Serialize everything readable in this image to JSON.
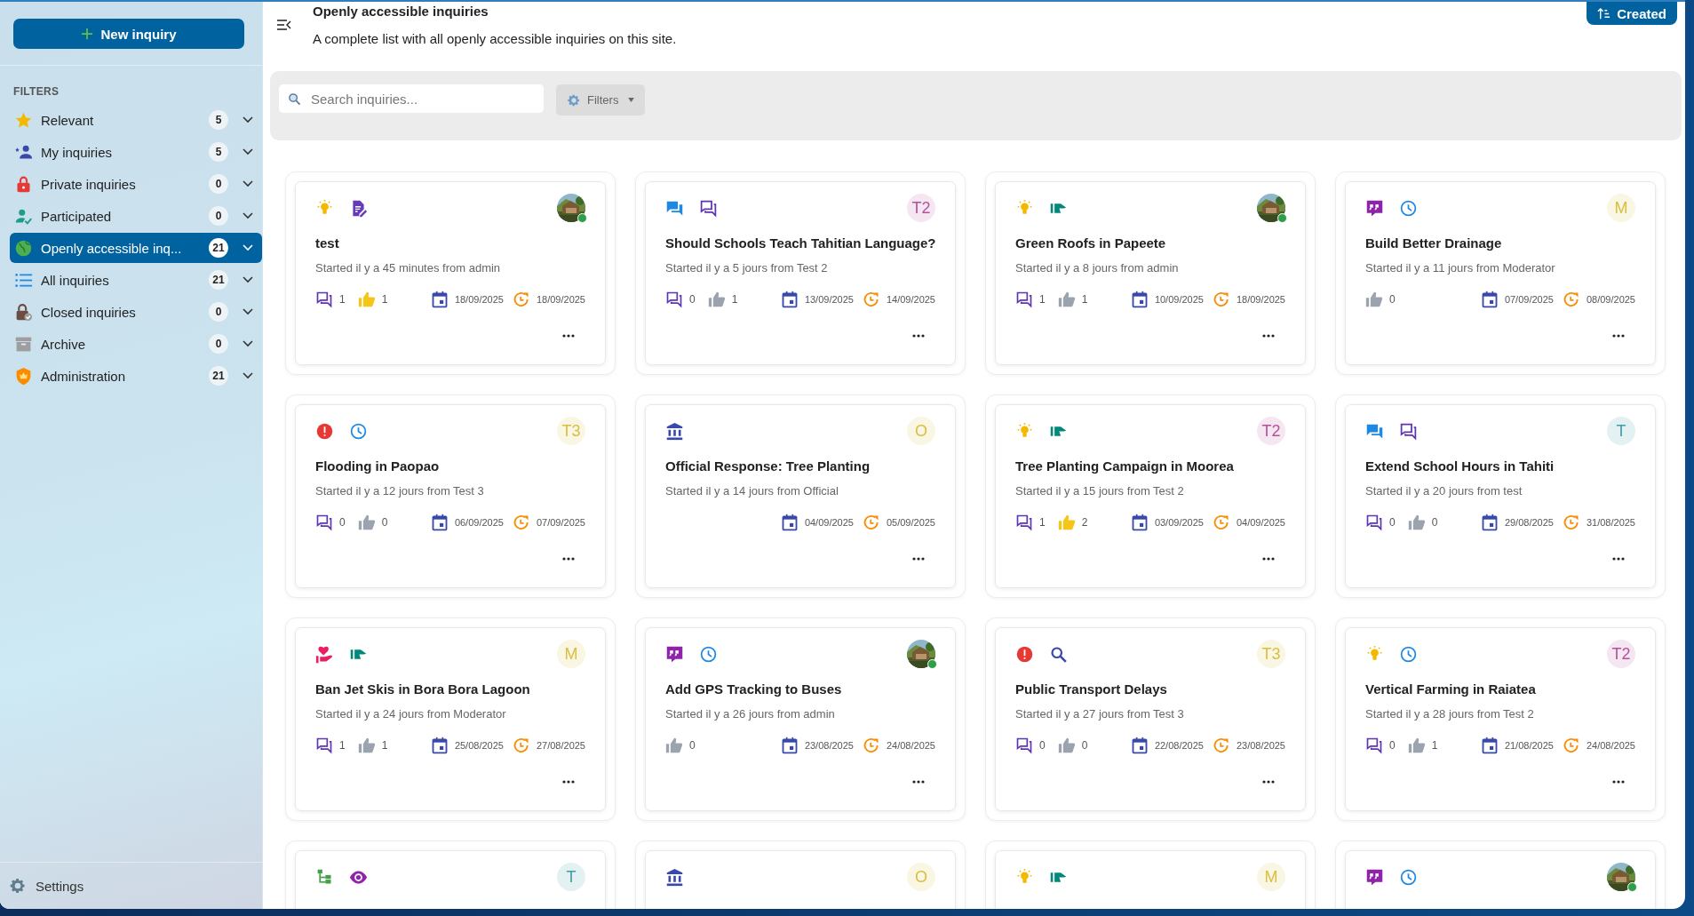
{
  "sidebar": {
    "new_button": "New inquiry",
    "section_label": "FILTERS",
    "items": [
      {
        "kind": "star",
        "label": "Relevant",
        "count": "5",
        "selected": false
      },
      {
        "kind": "people",
        "label": "My inquiries",
        "count": "5",
        "selected": false
      },
      {
        "kind": "lock",
        "label": "Private inquiries",
        "count": "0",
        "selected": false
      },
      {
        "kind": "participant",
        "label": "Participated",
        "count": "0",
        "selected": false
      },
      {
        "kind": "globe",
        "label": "Openly accessible inq...",
        "count": "21",
        "selected": true
      },
      {
        "kind": "list",
        "label": "All inquiries",
        "count": "21",
        "selected": false
      },
      {
        "kind": "closed",
        "label": "Closed inquiries",
        "count": "0",
        "selected": false
      },
      {
        "kind": "archive",
        "label": "Archive",
        "count": "0",
        "selected": false
      },
      {
        "kind": "shield",
        "label": "Administration",
        "count": "21",
        "selected": false
      }
    ],
    "settings": "Settings"
  },
  "header": {
    "title": "Openly accessible inquiries",
    "subtitle": "A complete list with all openly accessible inquiries on this site.",
    "sort_button": "Created"
  },
  "search": {
    "placeholder": "Search inquiries...",
    "filters_button": "Filters"
  },
  "cards": [
    {
      "icons": [
        {
          "kind": "idea"
        },
        {
          "kind": "draft"
        }
      ],
      "title": "test",
      "meta": "Started il y a 45 minutes from admin",
      "comments": "1",
      "likes": "1",
      "liked": true,
      "created": "18/09/2025",
      "updated": "18/09/2025"
    },
    {
      "icons": [
        {
          "kind": "chat"
        },
        {
          "kind": "discussion"
        }
      ],
      "avatar": {
        "kind": "initials",
        "text": "T2",
        "color": "#b5519c"
      },
      "title": "Should Schools Teach Tahitian Language?",
      "meta": "Started il y a 5 jours from Test 2",
      "comments": "0",
      "likes": "1",
      "liked": false,
      "created": "13/09/2025",
      "updated": "14/09/2025"
    },
    {
      "icons": [
        {
          "kind": "idea"
        },
        {
          "kind": "flag"
        }
      ],
      "title": "Green Roofs in Papeete",
      "meta": "Started il y a 8 jours from admin",
      "comments": "1",
      "likes": "1",
      "liked": false,
      "created": "10/09/2025",
      "updated": "18/09/2025"
    },
    {
      "icons": [
        {
          "kind": "quote"
        },
        {
          "kind": "clock"
        }
      ],
      "avatar": {
        "kind": "initials",
        "text": "M",
        "color": "#d9bf3f"
      },
      "title": "Build Better Drainage",
      "meta": "Started il y a 11 jours from Moderator",
      "likes": "0",
      "liked": false,
      "created": "07/09/2025",
      "updated": "08/09/2025"
    },
    {
      "icons": [
        {
          "kind": "alert"
        },
        {
          "kind": "clock"
        }
      ],
      "avatar": {
        "kind": "initials",
        "text": "T3",
        "color": "#d9bf3f"
      },
      "title": "Flooding in Paopao",
      "meta": "Started il y a 12 jours from Test 3",
      "comments": "0",
      "likes": "0",
      "liked": false,
      "created": "06/09/2025",
      "updated": "07/09/2025"
    },
    {
      "icons": [
        {
          "kind": "bank"
        }
      ],
      "avatar": {
        "kind": "initials",
        "text": "O",
        "color": "#d9bf3f"
      },
      "title": "Official Response: Tree Planting",
      "meta": "Started il y a 14 jours from Official",
      "created": "04/09/2025",
      "updated": "05/09/2025"
    },
    {
      "icons": [
        {
          "kind": "idea"
        },
        {
          "kind": "flag"
        }
      ],
      "avatar": {
        "kind": "initials",
        "text": "T2",
        "color": "#b5519c"
      },
      "title": "Tree Planting Campaign in Moorea",
      "meta": "Started il y a 15 jours from Test 2",
      "comments": "1",
      "likes": "2",
      "liked": true,
      "created": "03/09/2025",
      "updated": "04/09/2025"
    },
    {
      "icons": [
        {
          "kind": "chat"
        },
        {
          "kind": "discussion"
        }
      ],
      "avatar": {
        "kind": "initials",
        "text": "T",
        "color": "#3f9ea8"
      },
      "title": "Extend School Hours in Tahiti",
      "meta": "Started il y a 20 jours from test",
      "comments": "0",
      "likes": "0",
      "liked": false,
      "created": "29/08/2025",
      "updated": "31/08/2025"
    },
    {
      "icons": [
        {
          "kind": "heart"
        },
        {
          "kind": "flag"
        }
      ],
      "avatar": {
        "kind": "initials",
        "text": "M",
        "color": "#d9bf3f"
      },
      "title": "Ban Jet Skis in Bora Bora Lagoon",
      "meta": "Started il y a 24 jours from Moderator",
      "comments": "1",
      "likes": "1",
      "liked": false,
      "created": "25/08/2025",
      "updated": "27/08/2025"
    },
    {
      "icons": [
        {
          "kind": "quote"
        },
        {
          "kind": "clock"
        }
      ],
      "title": "Add GPS Tracking to Buses",
      "meta": "Started il y a 26 jours from admin",
      "likes": "0",
      "liked": false,
      "created": "23/08/2025",
      "updated": "24/08/2025"
    },
    {
      "icons": [
        {
          "kind": "alert"
        },
        {
          "kind": "search"
        }
      ],
      "avatar": {
        "kind": "initials",
        "text": "T3",
        "color": "#d9bf3f"
      },
      "title": "Public Transport Delays",
      "meta": "Started il y a 27 jours from Test 3",
      "comments": "0",
      "likes": "0",
      "liked": false,
      "created": "22/08/2025",
      "updated": "23/08/2025"
    },
    {
      "icons": [
        {
          "kind": "idea"
        },
        {
          "kind": "clock"
        }
      ],
      "avatar": {
        "kind": "initials",
        "text": "T2",
        "color": "#b5519c"
      },
      "title": "Vertical Farming in Raiatea",
      "meta": "Started il y a 28 jours from Test 2",
      "comments": "0",
      "likes": "1",
      "liked": false,
      "created": "21/08/2025",
      "updated": "24/08/2025"
    },
    {
      "icons": [
        {
          "kind": "tree"
        },
        {
          "kind": "eye"
        }
      ],
      "avatar": {
        "kind": "initials",
        "text": "T",
        "color": "#3f9ea8"
      }
    },
    {
      "icons": [
        {
          "kind": "bank"
        }
      ],
      "avatar": {
        "kind": "initials",
        "text": "O",
        "color": "#d9bf3f"
      }
    },
    {
      "icons": [
        {
          "kind": "idea"
        },
        {
          "kind": "flag"
        }
      ],
      "avatar": {
        "kind": "initials",
        "text": "M",
        "color": "#d9bf3f"
      }
    },
    {
      "icons": [
        {
          "kind": "quote"
        },
        {
          "kind": "clock"
        }
      ]
    }
  ]
}
